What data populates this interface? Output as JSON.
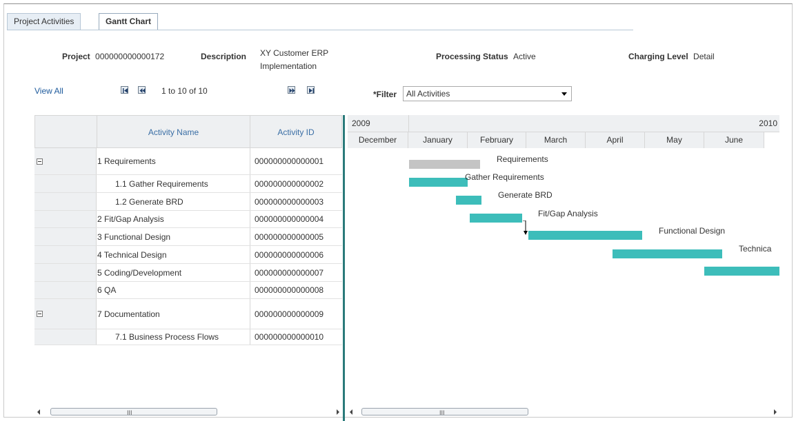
{
  "tabs": [
    {
      "label": "Project Activities",
      "active": false
    },
    {
      "label": "Gantt Chart",
      "active": true
    }
  ],
  "header": {
    "project_label": "Project",
    "project_value": "000000000000172",
    "description_label": "Description",
    "description_line1": "XY Customer ERP",
    "description_line2": "Implementation",
    "status_label": "Processing Status",
    "status_value": "Active",
    "charging_label": "Charging Level",
    "charging_value": "Detail"
  },
  "nav": {
    "view_all": "View All",
    "range": "1 to 10 of 10"
  },
  "filter": {
    "label": "*Filter",
    "value": "All Activities"
  },
  "grid": {
    "col_name": "Activity Name",
    "col_id": "Activity ID",
    "rows": [
      {
        "name": "1 Requirements",
        "id": "000000000000001",
        "expand": true,
        "indent": false
      },
      {
        "name": "1.1 Gather Requirements",
        "id": "000000000000002",
        "expand": false,
        "indent": true
      },
      {
        "name": "1.2 Generate BRD",
        "id": "000000000000003",
        "expand": false,
        "indent": true
      },
      {
        "name": "2 Fit/Gap Analysis",
        "id": "000000000000004",
        "expand": false,
        "indent": false
      },
      {
        "name": "3 Functional Design",
        "id": "000000000000005",
        "expand": false,
        "indent": false
      },
      {
        "name": "4 Technical Design",
        "id": "000000000000006",
        "expand": false,
        "indent": false
      },
      {
        "name": "5 Coding/Development",
        "id": "000000000000007",
        "expand": false,
        "indent": false
      },
      {
        "name": "6 QA",
        "id": "000000000000008",
        "expand": false,
        "indent": false
      },
      {
        "name": "7 Documentation",
        "id": "000000000000009",
        "expand": true,
        "indent": false
      },
      {
        "name": "7.1 Business Process Flows",
        "id": "000000000000010",
        "expand": false,
        "indent": true
      }
    ]
  },
  "gantt": {
    "years": [
      "2009",
      "2010"
    ],
    "months": [
      "December",
      "January",
      "February",
      "March",
      "April",
      "May",
      "June"
    ],
    "bar_colors": {
      "summary": "#c4c4c4",
      "task": "#3dbdba"
    },
    "bars": [
      {
        "label": "Requirements",
        "kind": "summary"
      },
      {
        "label": "Gather Requirements",
        "kind": "task"
      },
      {
        "label": "Generate BRD",
        "kind": "task"
      },
      {
        "label": "Fit/Gap Analysis",
        "kind": "task"
      },
      {
        "label": "Functional Design",
        "kind": "task"
      },
      {
        "label": "Technica",
        "kind": "task"
      },
      {
        "label": "",
        "kind": "task"
      }
    ]
  }
}
